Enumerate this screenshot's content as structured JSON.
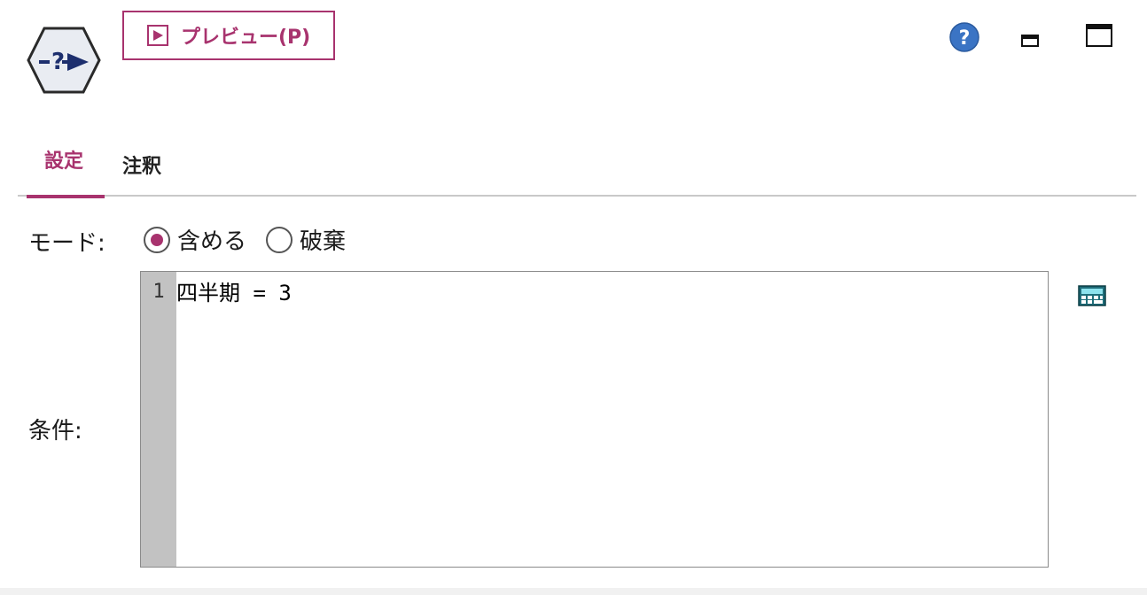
{
  "toolbar": {
    "preview_label": "プレビュー(P)",
    "node_icon": "select-node-icon",
    "help_icon": "help-icon",
    "minimize_icon": "minimize-icon",
    "maximize_icon": "maximize-icon"
  },
  "tabs": [
    {
      "label": "設定",
      "active": true
    },
    {
      "label": "注釈",
      "active": false
    }
  ],
  "mode": {
    "label": "モード:",
    "options": [
      {
        "label": "含める",
        "selected": true
      },
      {
        "label": "破棄",
        "selected": false
      }
    ]
  },
  "condition": {
    "label": "条件:",
    "lines": [
      {
        "number": "1",
        "text": "四半期 = 3"
      }
    ],
    "expression_builder_icon": "calculator-icon"
  },
  "colors": {
    "accent": "#a8336e",
    "gutter": "#c2c2c2",
    "help_blue": "#3b74c4",
    "node_navy": "#1d2f6e"
  }
}
